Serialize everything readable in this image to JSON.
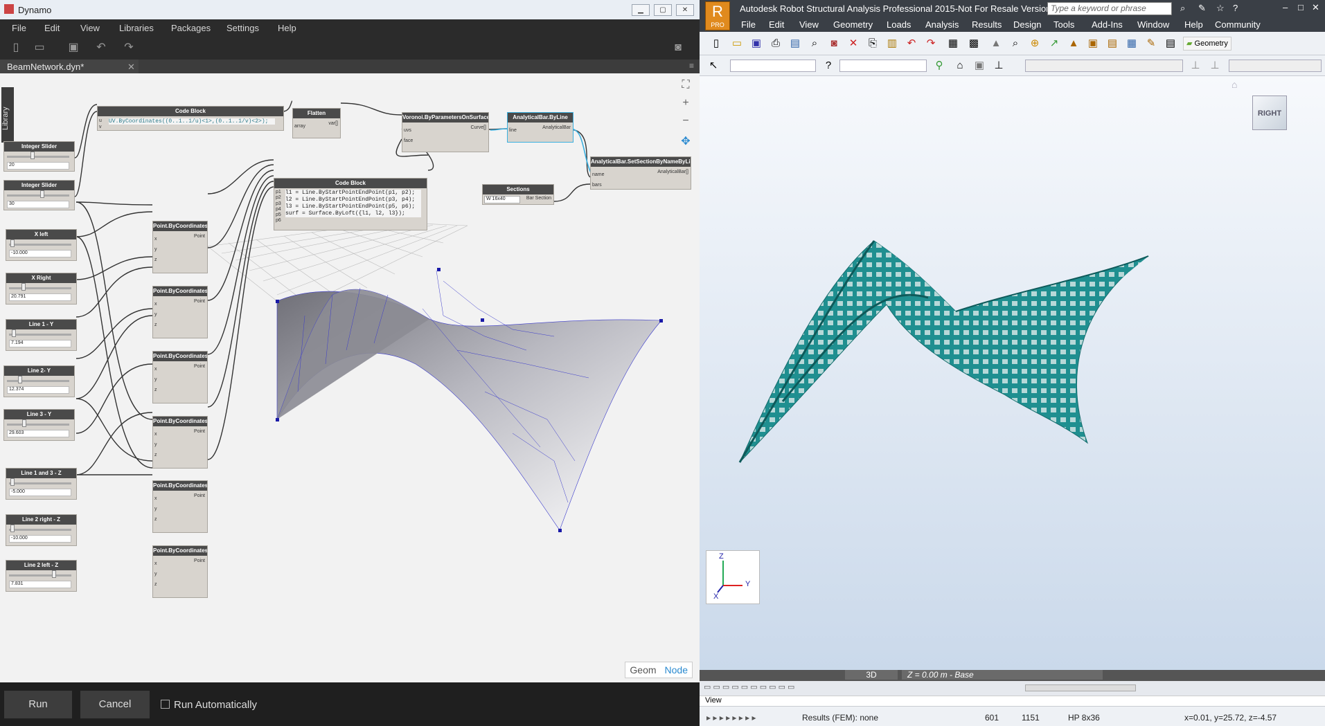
{
  "dynamo": {
    "title": "Dynamo",
    "menu": [
      "File",
      "Edit",
      "View",
      "Libraries",
      "Packages",
      "Settings",
      "Help"
    ],
    "tab_label": "BeamNetwork.dyn*",
    "library_label": "Library",
    "nodes": {
      "code_block_1": {
        "title": "Code Block",
        "code": "UV.ByCoordinates((0..1..1/u)<1>,(0..1..1/v)<2>);",
        "port_u": "u",
        "port_v": "v"
      },
      "flatten": {
        "title": "Flatten",
        "in": "array",
        "out": "var[]"
      },
      "voronoi": {
        "title": "Voronoi.ByParametersOnSurface",
        "in1": "uvs",
        "in2": "face",
        "out": "Curve[]"
      },
      "bar_by_line": {
        "title": "AnalyticalBar.ByLine",
        "in": "line",
        "out": "AnalyticalBar"
      },
      "set_section": {
        "title": "AnalyticalBar.SetSectionByNameByList",
        "in1": "name",
        "in2": "bars",
        "out": "AnalyticalBar[]"
      },
      "sections": {
        "title": "Sections",
        "value": "W 16x40",
        "out": "Bar Section"
      },
      "code_block_2": {
        "title": "Code Block",
        "lines": [
          "l1 = Line.ByStartPointEndPoint(p1, p2);",
          "l2 = Line.ByStartPointEndPoint(p3, p4);",
          "l3 = Line.ByStartPointEndPoint(p5, p6);",
          "surf = Surface.ByLoft({l1, l2, l3});"
        ],
        "ports": [
          "p1",
          "p2",
          "p3",
          "p4",
          "p5",
          "p6"
        ]
      },
      "int_slider_1": {
        "title": "Integer Slider",
        "value": "20"
      },
      "int_slider_2": {
        "title": "Integer Slider",
        "value": "30"
      },
      "point_title": "Point.ByCoordinates",
      "point_x": "x",
      "point_y": "y",
      "point_z": "z",
      "point_out": "Point",
      "sliders": [
        {
          "title": "X left",
          "value": "-10.000"
        },
        {
          "title": "X Right",
          "value": "20.791"
        },
        {
          "title": "Line 1 - Y",
          "value": "7.194"
        },
        {
          "title": "Line 2- Y",
          "value": "12.374"
        },
        {
          "title": "Line 3 - Y",
          "value": "29.603"
        },
        {
          "title": "Line 1 and 3 - Z",
          "value": "-5.000"
        },
        {
          "title": "Line 2 right - Z",
          "value": "-10.000"
        },
        {
          "title": "Line 2 left - Z",
          "value": "7.831"
        }
      ]
    },
    "geom_label": "Geom",
    "node_label": "Node",
    "run_label": "Run",
    "cancel_label": "Cancel",
    "run_auto_label": "Run Automatically"
  },
  "robot": {
    "title": "Autodesk Robot Structural Analysis Professional 2015-Not For Resale Version ...",
    "logo_text": "PRO",
    "search_placeholder": "Type a keyword or phrase",
    "menu": [
      "File",
      "Edit",
      "View",
      "Geometry",
      "Loads",
      "Analysis",
      "Results",
      "Design",
      "Tools",
      "Add-Ins",
      "Window",
      "Help",
      "Community"
    ],
    "geometry_button": "Geometry",
    "viewcube_label": "RIGHT",
    "view_3d": "3D",
    "view_level": "Z = 0.00 m - Base",
    "view_label": "View",
    "status_results": "Results (FEM): none",
    "status_601": "601",
    "status_1151": "1151",
    "status_section": "HP 8x36",
    "status_coords": "x=0.01, y=25.72, z=-4.57",
    "axis_z": "Z",
    "axis_y": "Y",
    "axis_x": "X"
  }
}
